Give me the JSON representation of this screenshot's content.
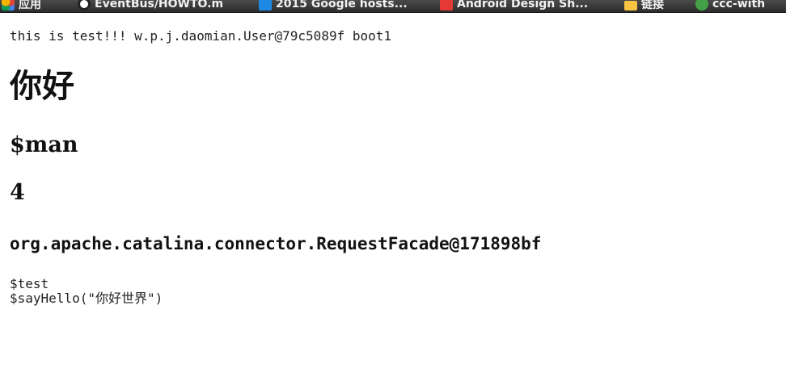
{
  "bookmarks": [
    {
      "label": "应用",
      "icon": "apps-grid-icon"
    },
    {
      "label": "EventBus/HOWTO.m",
      "icon": "github-icon"
    },
    {
      "label": "2015 Google hosts...",
      "icon": "blue-bookmark-icon"
    },
    {
      "label": "Android Design Sh...",
      "icon": "red-bookmark-icon"
    },
    {
      "label": "链接",
      "icon": "folder-icon"
    },
    {
      "label": "ссс-with",
      "icon": "green-bookmark-icon"
    }
  ],
  "page": {
    "line1": "this is test!!! w.p.j.daomian.User@79c5089f boot1",
    "heading1": "你好",
    "heading2": "$man",
    "heading3": "4",
    "heading4": "org.apache.catalina.connector.RequestFacade@171898bf",
    "pre_line1": "$test",
    "pre_line2": "$sayHello(\"你好世界\")"
  }
}
